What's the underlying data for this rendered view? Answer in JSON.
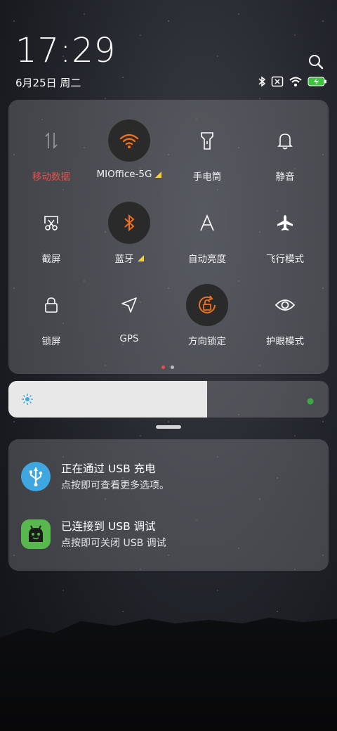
{
  "status_bar": {
    "time": "17:29",
    "date": "6月25日 周二"
  },
  "quick_settings": [
    {
      "label": "移动数据",
      "icon": "mobile-data-icon",
      "active": false,
      "label_color": "#e5524b",
      "warning": false
    },
    {
      "label": "MIOffice-5G",
      "icon": "wifi-icon",
      "active": true,
      "label_color": "#f0f0f0",
      "warning": true
    },
    {
      "label": "手电筒",
      "icon": "flashlight-icon",
      "active": false,
      "label_color": "#f0f0f0",
      "warning": false
    },
    {
      "label": "静音",
      "icon": "bell-icon",
      "active": false,
      "label_color": "#f0f0f0",
      "warning": false
    },
    {
      "label": "截屏",
      "icon": "screenshot-icon",
      "active": false,
      "label_color": "#f0f0f0",
      "warning": false
    },
    {
      "label": "蓝牙",
      "icon": "bluetooth-icon",
      "active": true,
      "label_color": "#f0f0f0",
      "warning": true
    },
    {
      "label": "自动亮度",
      "icon": "auto-brightness-icon",
      "active": false,
      "label_color": "#f0f0f0",
      "warning": false
    },
    {
      "label": "飞行模式",
      "icon": "airplane-icon",
      "active": false,
      "label_color": "#f0f0f0",
      "warning": false
    },
    {
      "label": "锁屏",
      "icon": "lock-icon",
      "active": false,
      "label_color": "#f0f0f0",
      "warning": false
    },
    {
      "label": "GPS",
      "icon": "gps-icon",
      "active": false,
      "label_color": "#f0f0f0",
      "warning": false
    },
    {
      "label": "方向锁定",
      "icon": "rotation-lock-icon",
      "active": true,
      "label_color": "#f0f0f0",
      "warning": false
    },
    {
      "label": "护眼模式",
      "icon": "eye-icon",
      "active": false,
      "label_color": "#f0f0f0",
      "warning": false
    }
  ],
  "page_dots": {
    "active_color": "#e5524b",
    "inactive_color": "#bdbdbd",
    "count": 2,
    "active_index": 0
  },
  "brightness": {
    "level": 0.62
  },
  "notifications": [
    {
      "title": "正在通过 USB 充电",
      "body": "点按即可查看更多选项。",
      "icon": "usb-icon",
      "icon_bg": "#3ea7e0"
    },
    {
      "title": "已连接到 USB 调试",
      "body": "点按即可关闭 USB 调试",
      "icon": "android-icon",
      "icon_bg": "#59b84d"
    }
  ],
  "colors": {
    "accent": "#f07020",
    "active_circle": "#2a2a2a",
    "warning": "#f5d232"
  }
}
